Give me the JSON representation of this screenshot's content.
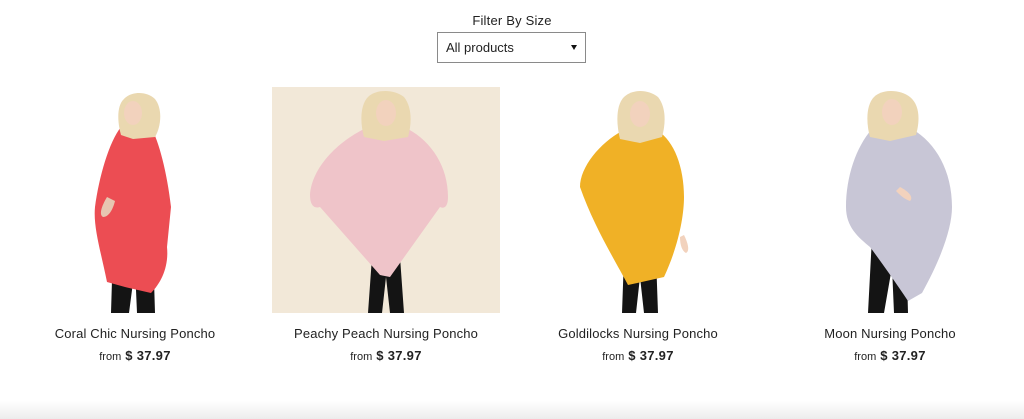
{
  "filter": {
    "label": "Filter By Size",
    "selected": "All products"
  },
  "products": [
    {
      "title": "Coral Chic Nursing Poncho",
      "from": "from",
      "price": "$ 37.97",
      "color": "#ec4d53",
      "photo_bg": "#ffffff"
    },
    {
      "title": "Peachy Peach Nursing Poncho",
      "from": "from",
      "price": "$ 37.97",
      "color": "#efc4c9",
      "photo_bg": "#f2e8d8"
    },
    {
      "title": "Goldilocks Nursing Poncho",
      "from": "from",
      "price": "$ 37.97",
      "color": "#f0b126",
      "photo_bg": "#ffffff"
    },
    {
      "title": "Moon Nursing Poncho",
      "from": "from",
      "price": "$ 37.97",
      "color": "#c8c6d6",
      "photo_bg": "#ffffff"
    }
  ]
}
